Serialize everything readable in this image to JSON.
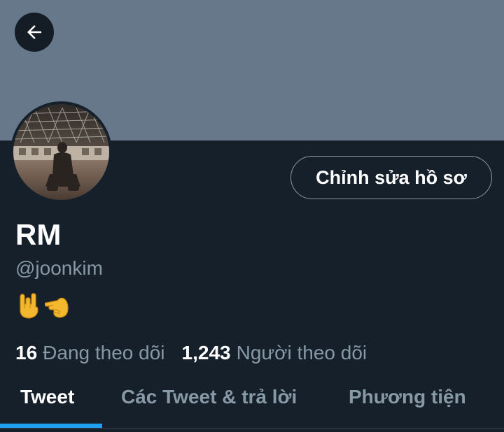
{
  "header": {
    "back_icon": "arrow-left-icon"
  },
  "profile": {
    "avatar_icon": "profile-photo-avatar",
    "edit_button_label": "Chỉnh sửa hồ sơ",
    "display_name": "RM",
    "handle": "@joonkim",
    "bio_emojis": [
      "rock-on-hand-emoji",
      "backhand-pointing-left-emoji"
    ]
  },
  "stats": {
    "following_count": "16",
    "following_label": "Đang theo dõi",
    "followers_count": "1,243",
    "followers_label": "Người theo dõi"
  },
  "tabs": [
    {
      "label": "Tweet",
      "active": true
    },
    {
      "label": "Các Tweet & trả lời",
      "active": false
    },
    {
      "label": "Phương tiện",
      "active": false
    }
  ],
  "colors": {
    "background": "#15202b",
    "banner": "#66788a",
    "accent": "#1da1f2",
    "secondary_text": "#8899a6"
  }
}
